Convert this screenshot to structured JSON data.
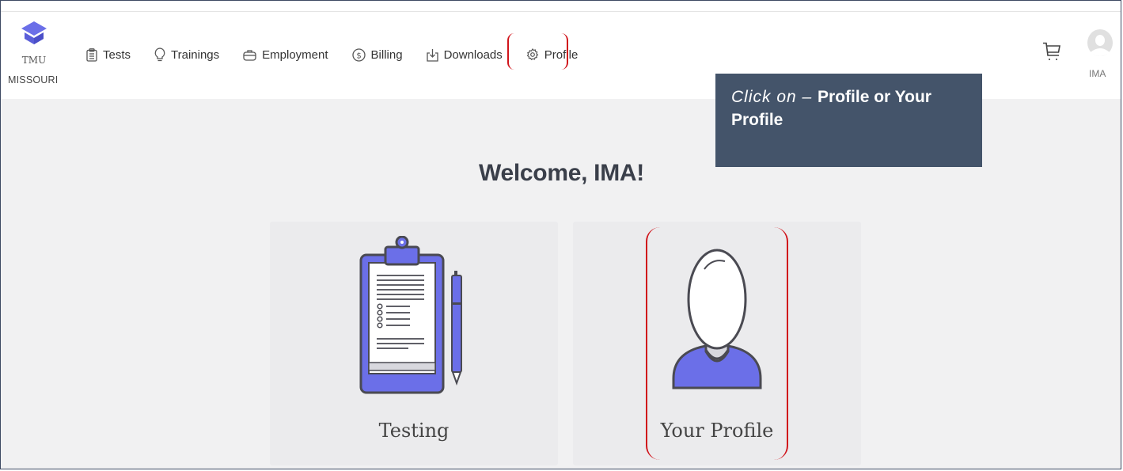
{
  "brand": {
    "line1": "TMU",
    "line2": "MISSOURI",
    "accent": "#6b6fe8"
  },
  "nav": {
    "items": [
      {
        "label": "Tests",
        "icon": "clipboard-icon"
      },
      {
        "label": "Trainings",
        "icon": "lightbulb-icon"
      },
      {
        "label": "Employment",
        "icon": "briefcase-icon"
      },
      {
        "label": "Billing",
        "icon": "dollar-circle-icon"
      },
      {
        "label": "Downloads",
        "icon": "download-icon"
      },
      {
        "label": "Profile",
        "icon": "gear-icon"
      }
    ]
  },
  "user": {
    "name": "IMA",
    "avatar_icon": "user-avatar-icon",
    "cart_icon": "cart-icon"
  },
  "callout": {
    "prefix": "Click on – ",
    "bold": "Profile or Your Profile",
    "color": "#44546a"
  },
  "main": {
    "welcome": "Welcome, IMA!",
    "cards": [
      {
        "label": "Testing",
        "icon": "clipboard-checklist-icon"
      },
      {
        "label": "Your Profile",
        "icon": "person-profile-icon"
      }
    ]
  },
  "highlight_color": "#d0141b"
}
